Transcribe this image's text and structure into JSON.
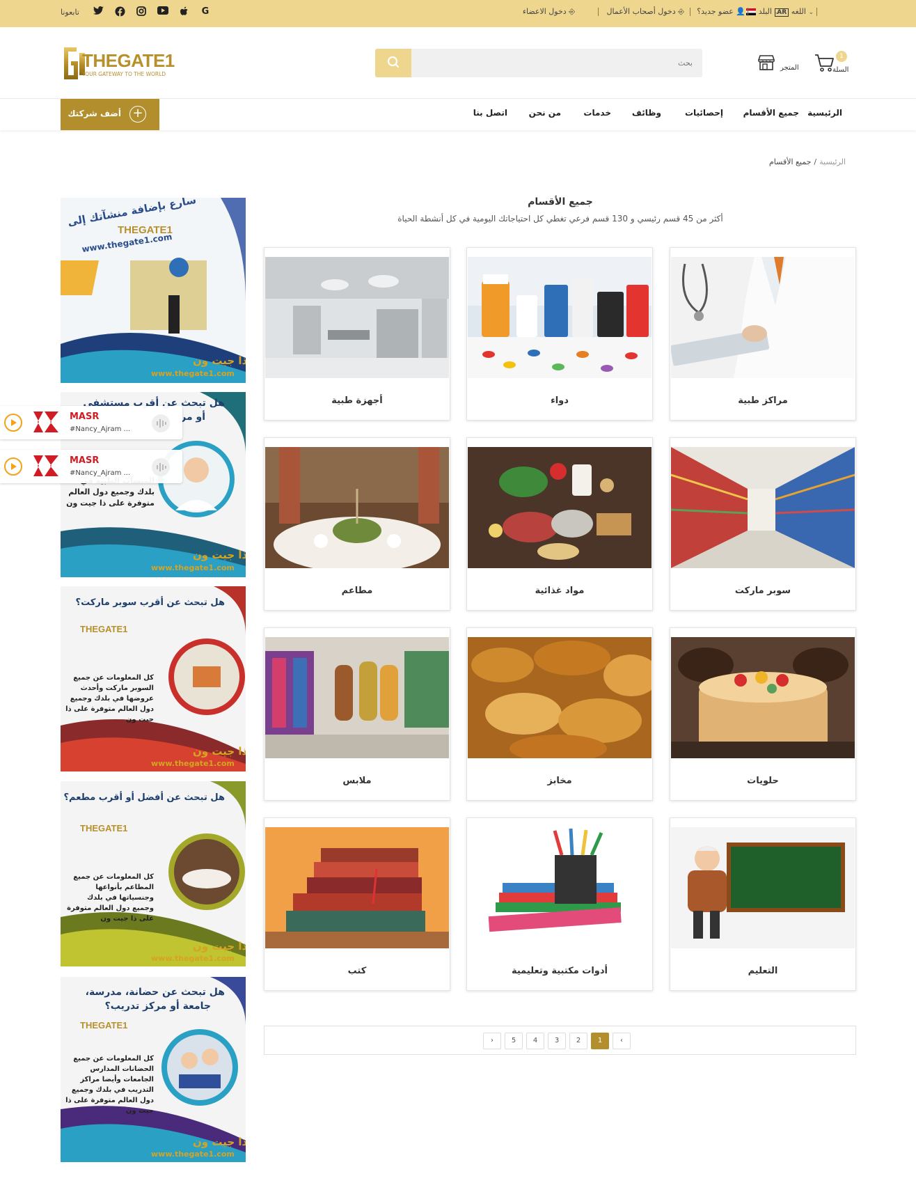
{
  "topbar": {
    "country_label": "البلد",
    "language_label": "اللغه",
    "language_code": "AR",
    "new_member": "عضو جديد؟",
    "business_login": "دخول أصحاب الأعمال",
    "member_login": "دخول الاعضاء",
    "follow_us": "تابعونا",
    "social_icons": [
      "google-icon",
      "apple-icon",
      "youtube-icon",
      "instagram-icon",
      "facebook-icon",
      "twitter-icon"
    ]
  },
  "header": {
    "logo_text": "THEGATE1",
    "logo_tagline": "YOUR GATEWAY TO THE WORLD",
    "search_placeholder": "بحث",
    "cart_label": "السلة",
    "cart_count": "1",
    "store_label": "المتجر"
  },
  "nav": {
    "items": [
      "الرئيسية",
      "جميع الأقسام",
      "إحصائيات",
      "وظائف",
      "خدمات",
      "من نحن",
      "اتصل بنا"
    ],
    "add_company": "أضف شركتك"
  },
  "breadcrumb": {
    "home": "الرئيسية",
    "separator": "/",
    "current": "جميع الأقسام"
  },
  "main": {
    "title": "جميع الأقسام",
    "subtitle": "أكثر من 45 قسم رئيسي و 130 قسم فرعي تغطي كل احتياجاتك اليومية في كل أنشطة الحياة",
    "categories": [
      "مراكز طبية",
      "دواء",
      "أجهزة طبية",
      "سوبر ماركت",
      "مواد غذائية",
      "مطاعم",
      "حلويات",
      "مخابز",
      "ملابس",
      "التعليم",
      "أدوات مكتبية وتعليمية",
      "كتب"
    ]
  },
  "pagination": {
    "prev": "‹",
    "pages": [
      "1",
      "2",
      "3",
      "4",
      "5"
    ],
    "next": "›",
    "current": "1"
  },
  "ads": [
    {
      "headline": "سارع بإضافة منشآتك إلى",
      "brand": "THEGATE1",
      "url": "www.thegate1.com",
      "footer_brand": "ذا جيت ون",
      "footer_url": "www.thegate1.com"
    },
    {
      "headline": "هل تبحث عن أقرب مستشفى",
      "line2": "أو مر",
      "body": "المنشآت الطبية في بلدك وجميع دول العالم متوفرة على ذا جيت ون",
      "footer_brand": "ذا جيت ون",
      "footer_url": "www.thegate1.com"
    },
    {
      "headline": "هل تبحث عن أقرب سوبر ماركت؟",
      "brand": "THEGATE1",
      "body": "كل المعلومات عن جميع السوبر ماركت وأحدث عروضها في بلدك وجميع دول العالم متوفرة على ذا جيت ون",
      "footer_brand": "ذا جيت ون",
      "footer_url": "www.thegate1.com"
    },
    {
      "headline": "هل تبحث عن أفضل أو أقرب مطعم؟",
      "brand": "THEGATE1",
      "body": "كل المعلومات عن جميع المطاعم بأنواعها وجنسياتها في بلدك وجميع دول العالم متوفرة على ذا جيت ون",
      "footer_brand": "ذا جيت ون",
      "footer_url": "www.thegate1.com"
    },
    {
      "headline": "هل تبحث عن حضانة، مدرسة،",
      "line2": "جامعة أو مركز تدريب؟",
      "brand": "THEGATE1",
      "body": "كل المعلومات عن جميع الحضانات المدارس الجامعات وأيضا مراكز التدريب في بلدك وجميع دول العالم متوفرة على ذا جيت ون",
      "footer_brand": "ذا جيت ون",
      "footer_url": "www.thegate1.com"
    }
  ],
  "radio_widgets": [
    {
      "station": "MASR",
      "track": "#Nancy_Ajram ..."
    },
    {
      "station": "MASR",
      "track": "#Nancy_Ajram ..."
    }
  ],
  "colors": {
    "topbar": "#efd68e",
    "gold": "#b28f2c",
    "accent_orange": "#f5a21b",
    "radio_red": "#d01c24"
  }
}
